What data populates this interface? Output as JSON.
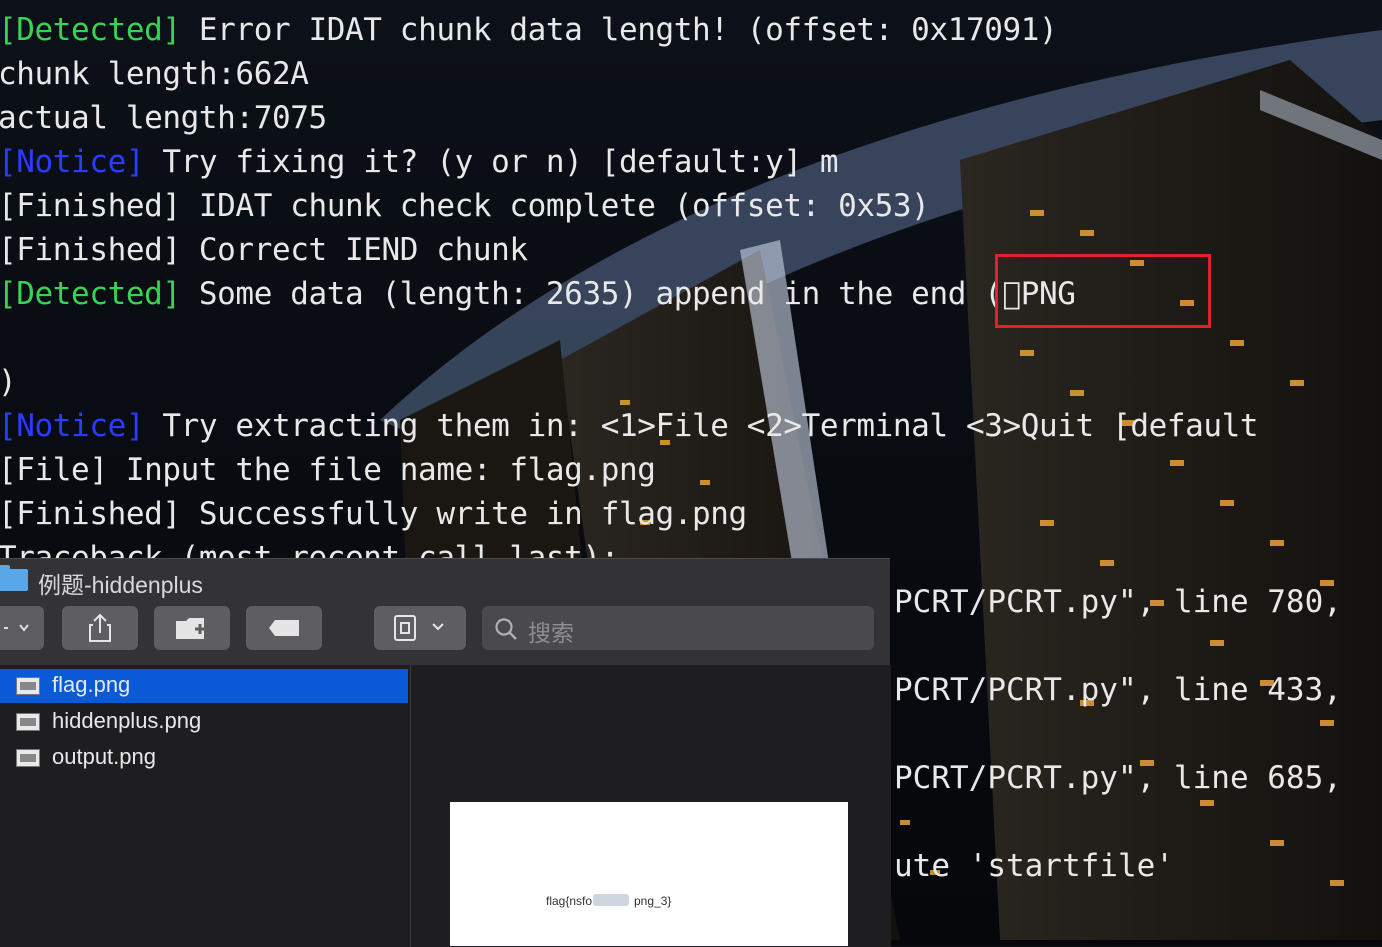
{
  "terminal": {
    "lines": [
      {
        "tag": "[Detected]",
        "text": " Error IDAT chunk data length! (offset: 0x17091)"
      },
      {
        "text": "chunk length:662A"
      },
      {
        "text": "actual length:7075"
      },
      {
        "tag": "[Notice]",
        "text": " Try fixing it? (y or n) [default:y] m"
      },
      {
        "text": "[Finished] IDAT chunk check complete (offset: 0x53)"
      },
      {
        "text": "[Finished] Correct IEND chunk"
      },
      {
        "tag": "[Detected]",
        "text": " Some data (length: 2635) append in the end (\u0000PNG"
      },
      {
        "text": ")"
      },
      {
        "tag": "[Notice]",
        "text": " Try extracting them in: <1>File <2>Terminal <3>Quit [default"
      },
      {
        "text": "[File] Input the file name: flag.png"
      },
      {
        "text": "[Finished] Successfully write in flag.png"
      },
      {
        "text": "Traceback (most recent call last):"
      }
    ],
    "right_lines": [
      "PCRT/PCRT.py\", line 780,",
      "PCRT/PCRT.py\", line 433,",
      "PCRT/PCRT.py\", line 685,",
      "ute 'startfile'"
    ]
  },
  "finder": {
    "title": "例题-hiddenplus",
    "search_placeholder": "搜索",
    "files": [
      "flag.png",
      "hiddenplus.png",
      "output.png"
    ],
    "selected": "flag.png",
    "preview": {
      "text_left": "flag{nsfo",
      "text_right": "png_3}"
    }
  },
  "colors": {
    "notice": "#2a3cff",
    "detected": "#39d353",
    "highlight": "#e3212b",
    "selection": "#0a5ad8"
  }
}
